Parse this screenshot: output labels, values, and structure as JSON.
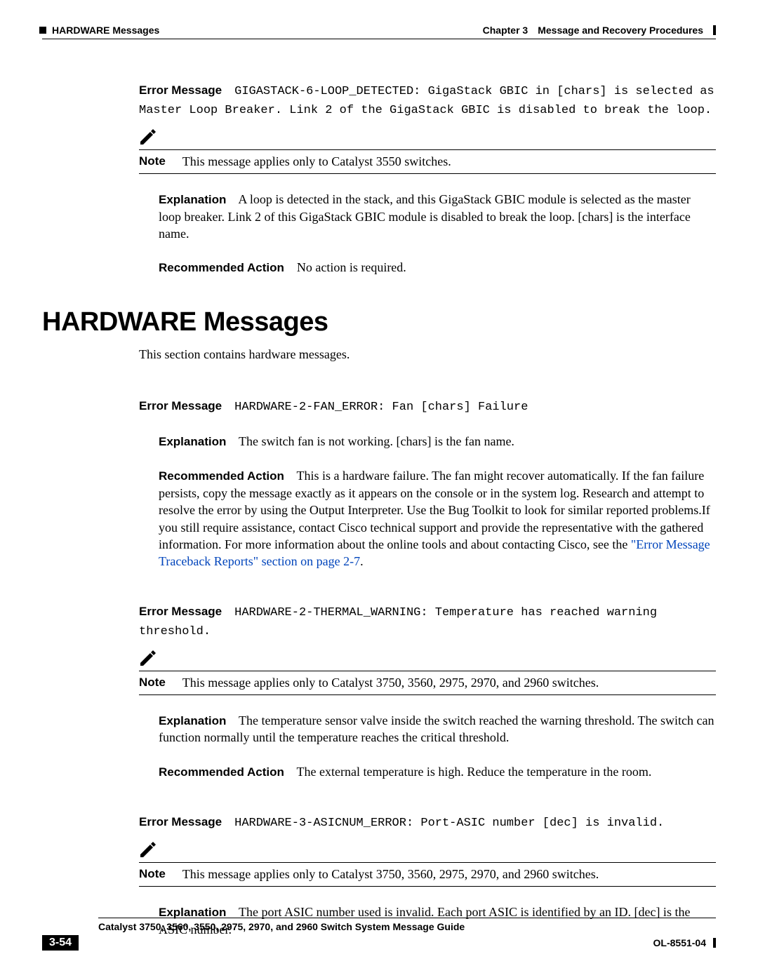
{
  "header": {
    "left": "HARDWARE Messages",
    "chapter_label": "Chapter 3",
    "chapter_title": "Message and Recovery Procedures"
  },
  "msg1": {
    "label": "Error Message",
    "code": "GIGASTACK-6-LOOP_DETECTED: GigaStack GBIC in [chars] is selected as Master Loop Breaker. Link 2 of the GigaStack GBIC is disabled to break the loop.",
    "note_label": "Note",
    "note_text": "This message applies only to Catalyst 3550 switches.",
    "explanation_label": "Explanation",
    "explanation_text": "A loop is detected in the stack, and this GigaStack GBIC module is selected as the master loop breaker. Link 2 of this GigaStack GBIC module is disabled to break the loop. [chars] is the interface name.",
    "action_label": "Recommended Action",
    "action_text": "No action is required."
  },
  "section": {
    "title": "HARDWARE Messages",
    "intro": "This section contains hardware messages."
  },
  "msg2": {
    "label": "Error Message",
    "code": "HARDWARE-2-FAN_ERROR: Fan [chars] Failure",
    "explanation_label": "Explanation",
    "explanation_text": "The switch fan is not working. [chars] is the fan name.",
    "action_label": "Recommended Action",
    "action_text_before": "This is a hardware failure. The fan might recover automatically. If the fan failure persists, copy the message exactly as it appears on the console or in the system log. Research and attempt to resolve the error by using the Output Interpreter. Use the Bug Toolkit to look for similar reported problems.If you still require assistance, contact Cisco technical support and provide the representative with the gathered information. For more information about the online tools and about contacting Cisco, see the ",
    "link_text": "\"Error Message Traceback Reports\" section on page 2-7",
    "action_text_after": "."
  },
  "msg3": {
    "label": "Error Message",
    "code": "HARDWARE-2-THERMAL_WARNING: Temperature has reached warning threshold.",
    "note_label": "Note",
    "note_text": "This message applies only to Catalyst 3750, 3560, 2975, 2970, and 2960 switches.",
    "explanation_label": "Explanation",
    "explanation_text": "The temperature sensor valve inside the switch reached the warning threshold. The switch can function normally until the temperature reaches the critical threshold.",
    "action_label": "Recommended Action",
    "action_text": "The external temperature is high. Reduce the temperature in the room."
  },
  "msg4": {
    "label": "Error Message",
    "code": "HARDWARE-3-ASICNUM_ERROR: Port-ASIC number [dec] is invalid.",
    "note_label": "Note",
    "note_text": "This message applies only to Catalyst 3750, 3560, 2975, 2970, and 2960 switches.",
    "explanation_label": "Explanation",
    "explanation_text": "The port ASIC number used is invalid. Each port ASIC is identified by an ID. [dec] is the ASIC number."
  },
  "footer": {
    "guide": "Catalyst 3750, 3560, 3550, 2975, 2970, and 2960 Switch System Message Guide",
    "page": "3-54",
    "docid": "OL-8551-04"
  }
}
